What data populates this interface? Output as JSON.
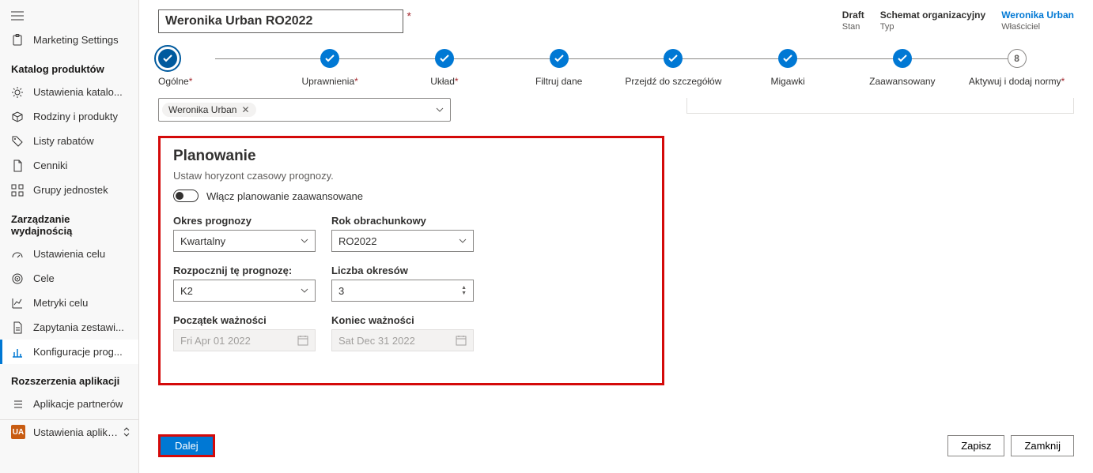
{
  "sidebar": {
    "topItem": "Marketing Settings",
    "sections": [
      {
        "title": "Katalog produktów",
        "items": [
          "Ustawienia katalo...",
          "Rodziny i produkty",
          "Listy rabatów",
          "Cenniki",
          "Grupy jednostek"
        ]
      },
      {
        "title": "Zarządzanie wydajnością",
        "items": [
          "Ustawienia celu",
          "Cele",
          "Metryki celu",
          "Zapytania zestawi...",
          "Konfiguracje prog..."
        ]
      },
      {
        "title": "Rozszerzenia aplikacji",
        "items": [
          "Aplikacje partnerów"
        ]
      }
    ],
    "appSettings": {
      "badge": "UA",
      "label": "Ustawienia aplikacji"
    }
  },
  "header": {
    "title": "Weronika Urban RO2022",
    "status": {
      "top": "Draft",
      "bottom": "Stan"
    },
    "schema": {
      "top": "Schemat organizacyjny",
      "bottom": "Typ"
    },
    "owner": {
      "top": "Weronika Urban",
      "bottom": "Właściciel"
    }
  },
  "steps": [
    {
      "label": "Ogólne",
      "req": true,
      "state": "current"
    },
    {
      "label": "Uprawnienia",
      "req": true,
      "state": "done"
    },
    {
      "label": "Układ",
      "req": true,
      "state": "done"
    },
    {
      "label": "Filtruj dane",
      "req": false,
      "state": "done"
    },
    {
      "label": "Przejdź do szczegółów",
      "req": false,
      "state": "done"
    },
    {
      "label": "Migawki",
      "req": false,
      "state": "done"
    },
    {
      "label": "Zaawansowany",
      "req": false,
      "state": "done"
    },
    {
      "label": "Aktywuj i dodaj normy",
      "req": true,
      "state": "pending",
      "num": "8"
    }
  ],
  "pill": "Weronika Urban",
  "planning": {
    "title": "Planowanie",
    "subtitle": "Ustaw horyzont czasowy prognozy.",
    "toggleLabel": "Włącz planowanie zaawansowane",
    "fields": {
      "periodLabel": "Okres prognozy",
      "periodValue": "Kwartalny",
      "yearLabel": "Rok obrachunkowy",
      "yearValue": "RO2022",
      "startLabel": "Rozpocznij tę prognozę:",
      "startValue": "K2",
      "countLabel": "Liczba okresów",
      "countValue": "3",
      "validFromLabel": "Początek ważności",
      "validFromValue": "Fri Apr 01 2022",
      "validToLabel": "Koniec ważności",
      "validToValue": "Sat Dec 31 2022"
    }
  },
  "footer": {
    "next": "Dalej",
    "save": "Zapisz",
    "close": "Zamknij"
  }
}
